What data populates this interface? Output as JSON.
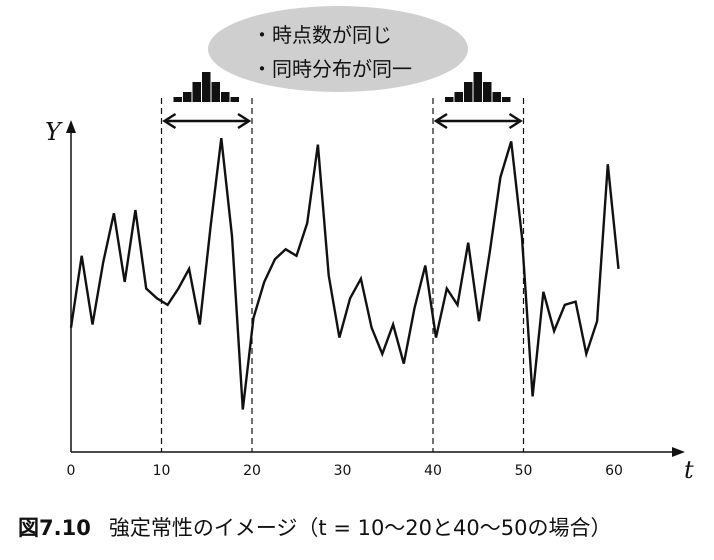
{
  "bubble": {
    "line1": "・時点数が同じ",
    "line2": "・同時分布が同一"
  },
  "caption": {
    "number": "図7.10",
    "text": "強定常性のイメージ（t = 10〜20と40〜50の場合）"
  },
  "chart_data": {
    "type": "line",
    "xlabel": "t",
    "ylabel": "Y",
    "x_ticks": [
      "0",
      "10",
      "20",
      "30",
      "40",
      "50",
      "60"
    ],
    "xlim": [
      0,
      67
    ],
    "ylim": [
      0,
      100
    ],
    "windows": [
      [
        10,
        20
      ],
      [
        40,
        50
      ]
    ],
    "series": [
      {
        "values": [
          38,
          60,
          39,
          58,
          73,
          52,
          74,
          50,
          47,
          45,
          50,
          56,
          39,
          69,
          96,
          66,
          13,
          41,
          52,
          59,
          62,
          60,
          70,
          94,
          54,
          35,
          47,
          53,
          38,
          30,
          39,
          27,
          44,
          57,
          35,
          50,
          45,
          64,
          40,
          61,
          84,
          95,
          66,
          17,
          49,
          37,
          45,
          46,
          30,
          40,
          88,
          56
        ]
      }
    ],
    "histogram_heights": [
      1,
      2,
      4,
      6,
      4,
      2,
      1
    ]
  }
}
